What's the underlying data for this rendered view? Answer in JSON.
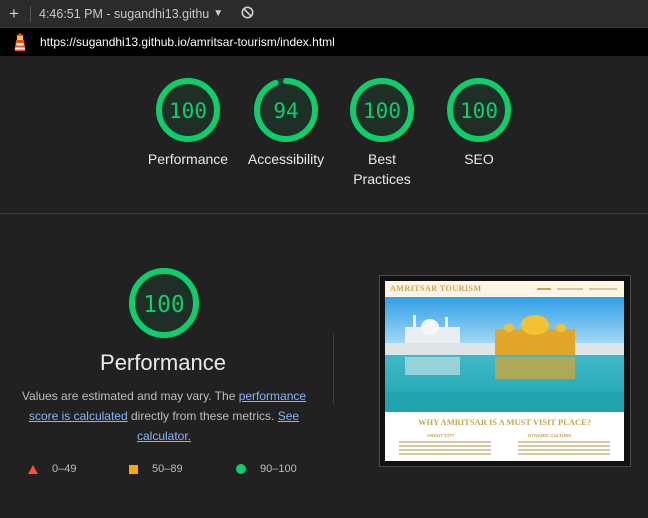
{
  "toolbar": {
    "plus_glyph": "+",
    "time_label": "4:46:51 PM - sugandhi13.githu",
    "caret_glyph": "▼",
    "new_icon": "plus-icon",
    "caret_icon": "chevron-down-icon",
    "block_icon": "block-icon"
  },
  "url": {
    "text": "https://sugandhi13.github.io/amritsar-tourism/index.html",
    "icon": "lighthouse-icon"
  },
  "colors": {
    "pass": "#0cce6b",
    "average": "#ffa400",
    "fail": "#ff4e42",
    "link": "#8ab4f8"
  },
  "gauges": [
    {
      "label": "Performance",
      "score": "100",
      "value": 100
    },
    {
      "label": "Accessibility",
      "score": "94",
      "value": 94
    },
    {
      "label": "Best Practices",
      "score": "100",
      "value": 100
    },
    {
      "label": "SEO",
      "score": "100",
      "value": 100
    }
  ],
  "performance": {
    "score": "100",
    "value": 100,
    "title": "Performance",
    "desc_prefix": "Values are estimated and may vary. The ",
    "desc_link1": "performance score is calculated",
    "desc_mid": " directly from these metrics. ",
    "desc_link2": "See calculator.",
    "legend": [
      {
        "range": "0–49",
        "icon": "triangle-icon"
      },
      {
        "range": "50–89",
        "icon": "square-icon"
      },
      {
        "range": "90–100",
        "icon": "circle-icon"
      }
    ]
  },
  "screenshot": {
    "brand": "AMRITSAR TOURISM",
    "heading": "WHY AMRITSAR IS A MUST VISIT PLACE?",
    "col1": "ABOUT CITY",
    "col2": "DYNAMIC CULTURE"
  }
}
